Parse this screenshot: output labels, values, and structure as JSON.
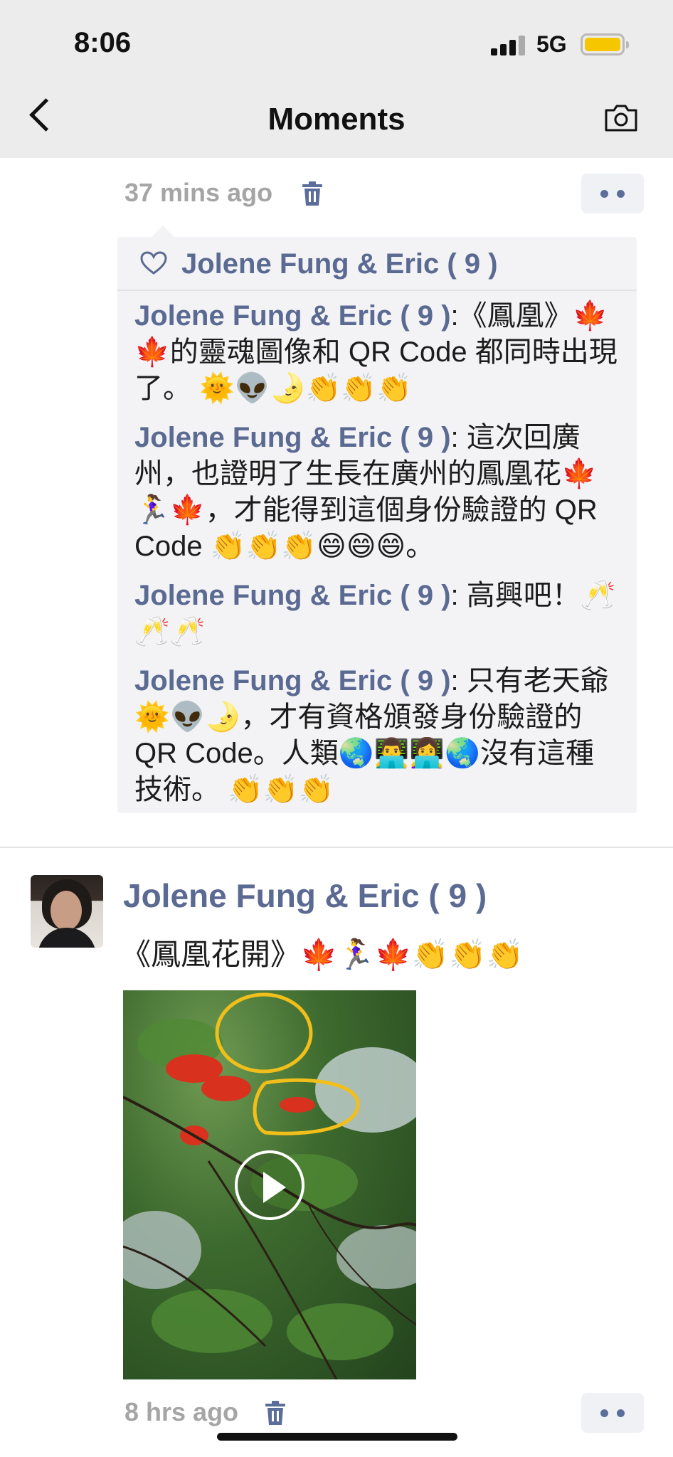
{
  "status_bar": {
    "time": "8:06",
    "network": "5G"
  },
  "nav": {
    "title": "Moments",
    "back_icon": "chevron-left-icon",
    "camera_icon": "camera-icon"
  },
  "post1": {
    "timestamp": "37 mins ago",
    "likes": {
      "icon": "heart-outline-icon",
      "names": "Jolene Fung & Eric ( 9 )"
    },
    "comments": [
      {
        "author": "Jolene Fung & Eric ( 9 )",
        "text": ":《鳳凰》🍁🍁的靈魂圖像和 QR Code 都同時出現了。 🌞👽🌛👏👏👏"
      },
      {
        "author": "Jolene Fung & Eric ( 9 )",
        "text": ": 這次回廣州，也證明了生長在廣州的鳳凰花🍁🏃‍♀️🍁，才能得到這個身份驗證的 QR Code 👏👏👏😄😄😄。"
      },
      {
        "author": "Jolene Fung & Eric ( 9 )",
        "text": ": 高興吧！🥂🥂🥂"
      },
      {
        "author": "Jolene Fung & Eric ( 9 )",
        "text": ": 只有老天爺🌞👽🌛，才有資格頒發身份驗證的 QR Code。人類🌏👨‍💻👩‍💻🌏沒有這種技術。 👏👏👏"
      }
    ]
  },
  "post2": {
    "author": "Jolene Fung & Eric ( 9 )",
    "text": "《鳳凰花開》🍁🏃‍♀️🍁👏👏👏",
    "timestamp": "8 hrs ago"
  },
  "colors": {
    "name_blue": "#5b6a92",
    "timestamp_gray": "#a5a5a5",
    "accent_yellow": "#f6c600"
  }
}
